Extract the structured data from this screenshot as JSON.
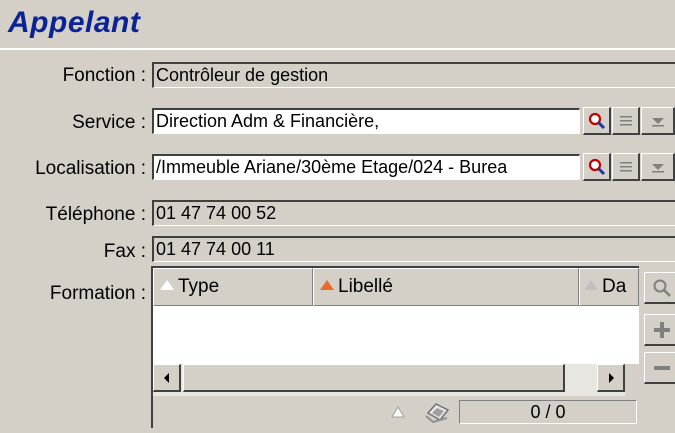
{
  "section": {
    "title": "Appelant"
  },
  "fields": {
    "fonction": {
      "label": "Fonction :",
      "value": "Contrôleur de gestion"
    },
    "service": {
      "label": "Service :",
      "value": "Direction Adm & Financière,"
    },
    "localisation": {
      "label": "Localisation :",
      "value": "/Immeuble Ariane/30ème Etage/024 - Burea"
    },
    "telephone": {
      "label": "Téléphone :",
      "value": "01 47 74 00 52"
    },
    "fax": {
      "label": "Fax :",
      "value": "01 47 74 00 11"
    }
  },
  "formation": {
    "label": "Formation :",
    "columns": [
      "Type",
      "Libellé",
      "Da"
    ],
    "counter": "0 / 0"
  },
  "icons": [
    "magnifier-icon",
    "list-icon",
    "dropdown-arrow-icon",
    "add-icon",
    "remove-icon",
    "sort-icon",
    "refresh-icon"
  ]
}
